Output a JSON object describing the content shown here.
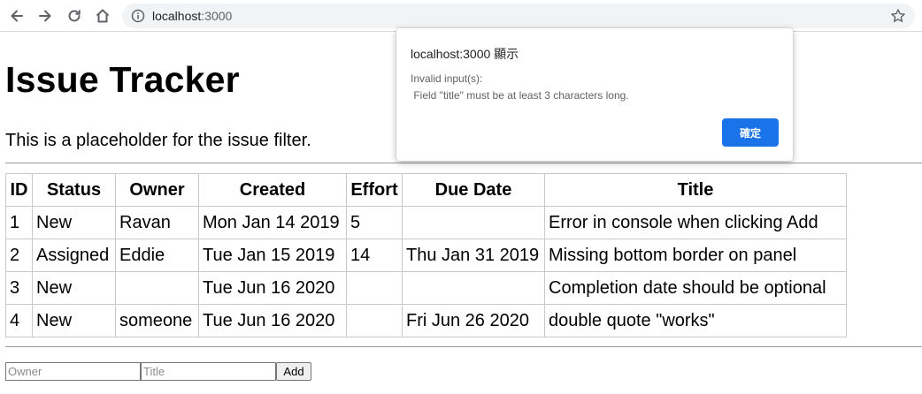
{
  "browser": {
    "url_host": "localhost",
    "url_port": ":3000",
    "icons": [
      "back-icon",
      "forward-icon",
      "reload-icon",
      "home-icon",
      "info-icon",
      "star-icon"
    ]
  },
  "page": {
    "title": "Issue Tracker",
    "filter_placeholder": "This is a placeholder for the issue filter."
  },
  "table": {
    "headers": [
      "ID",
      "Status",
      "Owner",
      "Created",
      "Effort",
      "Due Date",
      "Title"
    ],
    "rows": [
      [
        "1",
        "New",
        "Ravan",
        "Mon Jan 14 2019",
        "5",
        "",
        "Error in console when clicking Add"
      ],
      [
        "2",
        "Assigned",
        "Eddie",
        "Tue Jan 15 2019",
        "14",
        "Thu Jan 31 2019",
        "Missing bottom border on panel"
      ],
      [
        "3",
        "New",
        "",
        "Tue Jun 16 2020",
        "",
        "",
        "Completion date should be optional"
      ],
      [
        "4",
        "New",
        "someone",
        "Tue Jun 16 2020",
        "",
        "Fri Jun 26 2020",
        "double quote \"works\""
      ]
    ]
  },
  "add_form": {
    "owner_placeholder": "Owner",
    "title_placeholder": "Title",
    "add_label": "Add"
  },
  "dialog": {
    "title": "localhost:3000 顯示",
    "message_line1": "Invalid input(s):",
    "message_line2": " Field \"title\" must be at least 3 characters long.",
    "ok_label": "確定",
    "ok_color": "#1a73e8"
  }
}
